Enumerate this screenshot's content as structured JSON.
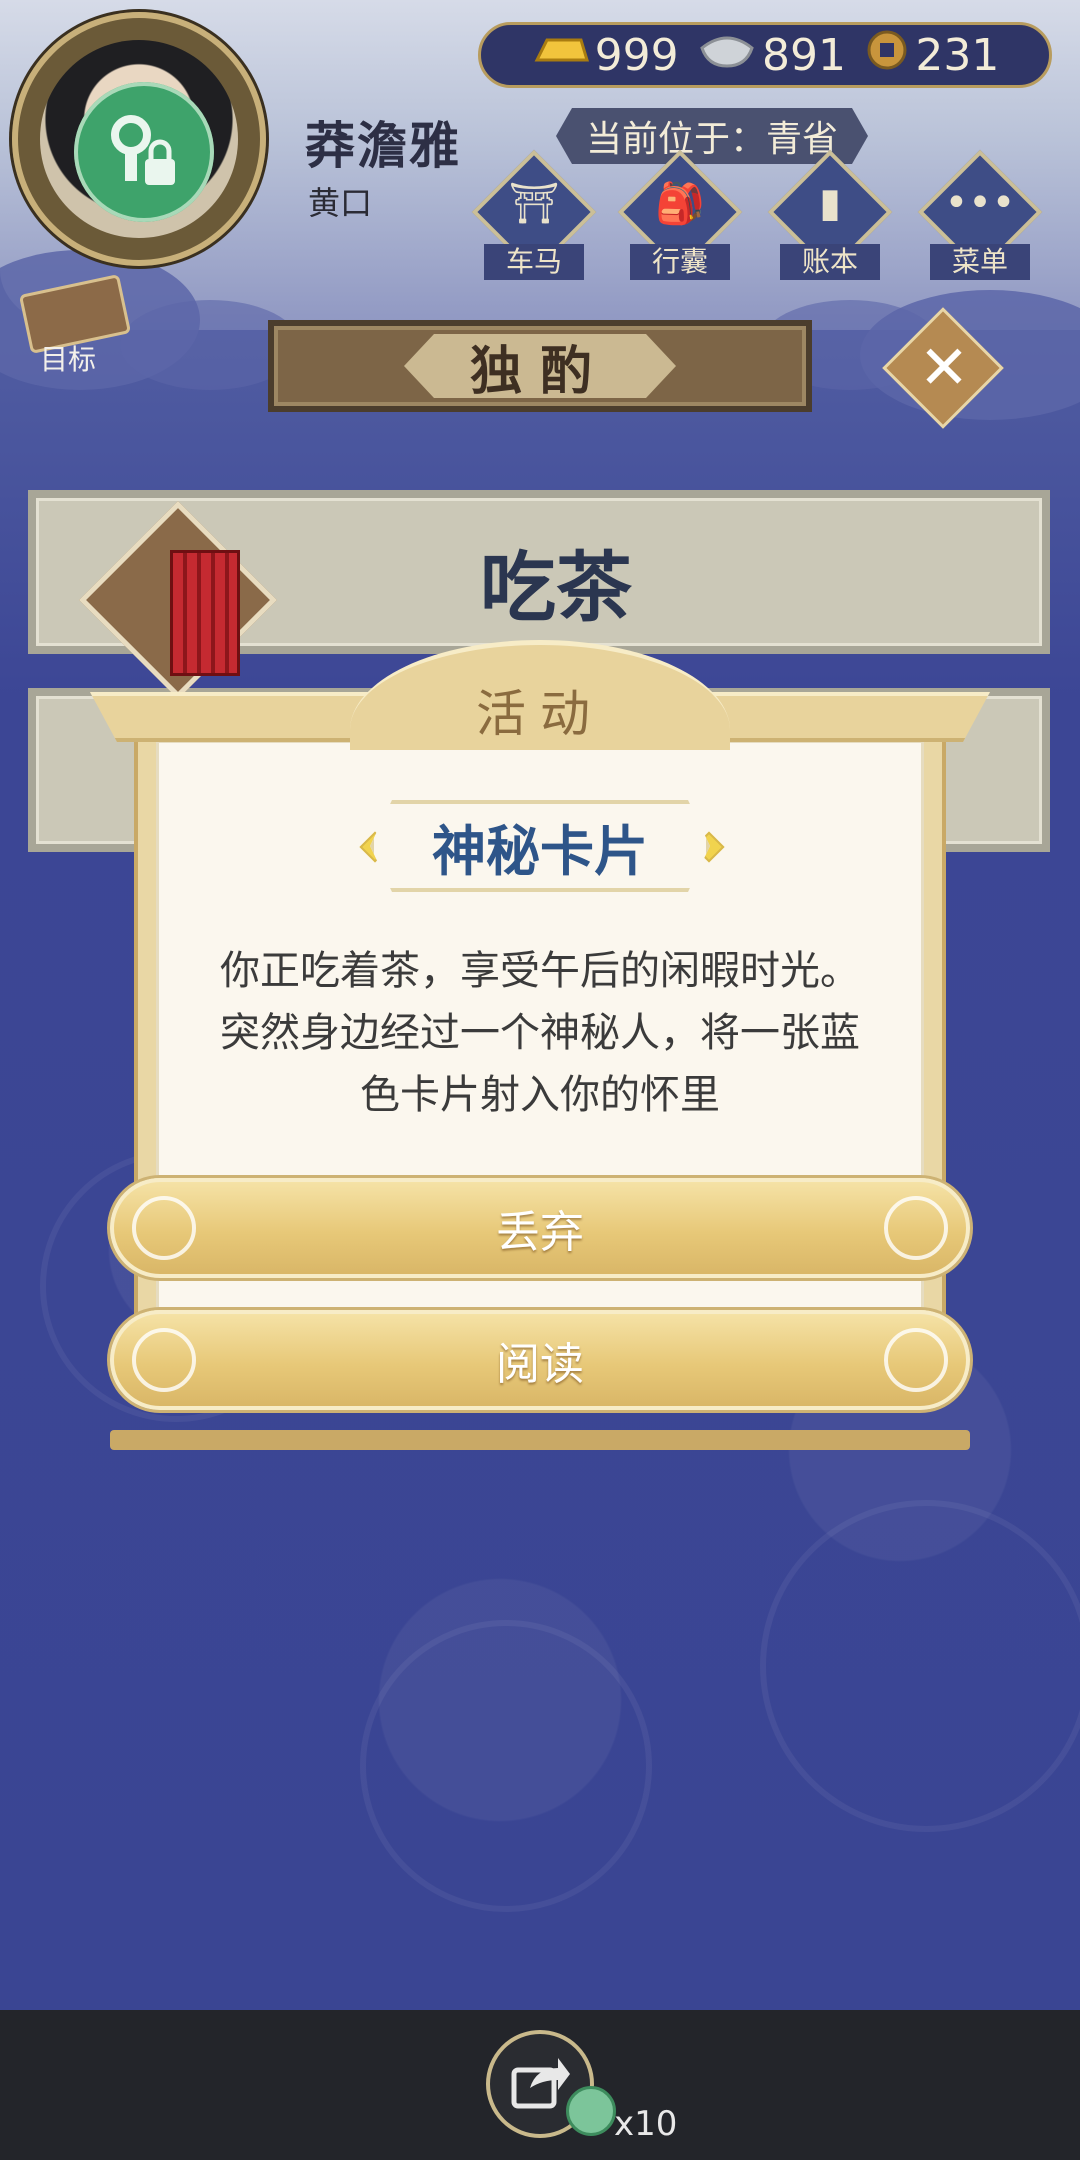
{
  "player": {
    "name": "莽澹雅",
    "title": "黄口"
  },
  "currency": {
    "gold": "999",
    "silver": "891",
    "copper": "231"
  },
  "location": {
    "label": "当前位于：青省"
  },
  "nav": [
    {
      "label": "车马",
      "icon": "carriage-icon"
    },
    {
      "label": "行囊",
      "icon": "bag-icon"
    },
    {
      "label": "账本",
      "icon": "ledger-icon"
    },
    {
      "label": "菜单",
      "icon": "menu-icon"
    }
  ],
  "goal": {
    "label": "目标"
  },
  "header": {
    "title": "独酌"
  },
  "activity_row": {
    "title": "吃茶"
  },
  "dialog": {
    "heading": "活动",
    "card_name": "神秘卡片",
    "text": "你正吃着茶，享受午后的闲暇时光。突然身边经过一个神秘人，将一张蓝色卡片射入你的怀里",
    "discard_label": "丢弃",
    "read_label": "阅读"
  },
  "share": {
    "count": "x10"
  },
  "colors": {
    "accent_gold": "#e7c878",
    "card_name_blue": "#2e5589",
    "background": "#3b4590"
  }
}
